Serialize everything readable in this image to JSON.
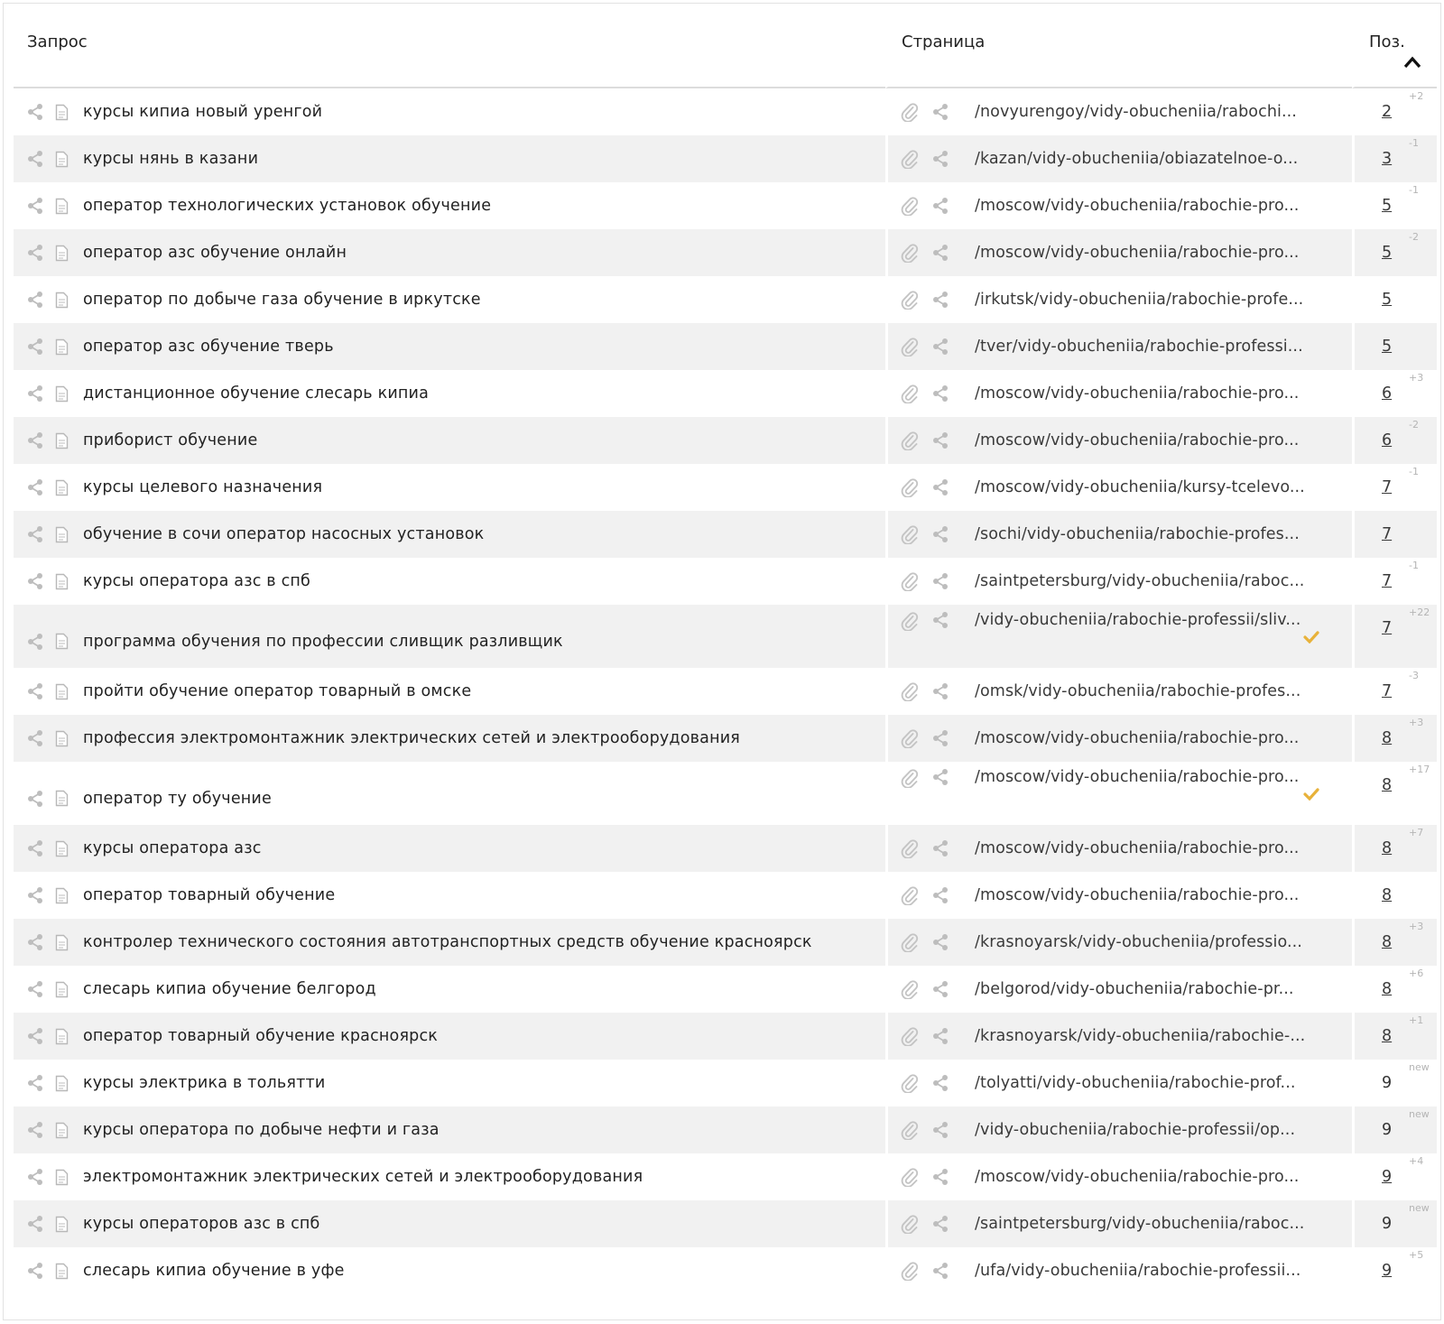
{
  "columns": {
    "query": "Запрос",
    "page": "Страница",
    "position": "Поз."
  },
  "icons": {
    "share": "share-icon",
    "document": "document-icon",
    "link": "paperclip-icon",
    "sort": "chevron-up-icon",
    "check": "checkmark-icon"
  },
  "colors": {
    "check": "#e8b23a",
    "stripe": "#f1f1f1",
    "delta": "#b5b5b5"
  },
  "rows": [
    {
      "query": "курсы кипиа новый уренгой",
      "page": "/novyurengoy/vidy-obucheniia/rabochi...",
      "pos": "2",
      "pos_link": true,
      "delta": "+2",
      "check": false
    },
    {
      "query": "курсы нянь в казани",
      "page": "/kazan/vidy-obucheniia/obiazatelnoe-o...",
      "pos": "3",
      "pos_link": true,
      "delta": "-1",
      "check": false
    },
    {
      "query": "оператор технологических установок обучение",
      "page": "/moscow/vidy-obucheniia/rabochie-pro...",
      "pos": "5",
      "pos_link": true,
      "delta": "-1",
      "check": false
    },
    {
      "query": "оператор азс обучение онлайн",
      "page": "/moscow/vidy-obucheniia/rabochie-pro...",
      "pos": "5",
      "pos_link": true,
      "delta": "-2",
      "check": false
    },
    {
      "query": "оператор по добыче газа обучение в иркутске",
      "page": "/irkutsk/vidy-obucheniia/rabochie-profe...",
      "pos": "5",
      "pos_link": true,
      "delta": "",
      "check": false
    },
    {
      "query": "оператор азс обучение тверь",
      "page": "/tver/vidy-obucheniia/rabochie-professi...",
      "pos": "5",
      "pos_link": true,
      "delta": "",
      "check": false
    },
    {
      "query": "дистанционное обучение слесарь кипиа",
      "page": "/moscow/vidy-obucheniia/rabochie-pro...",
      "pos": "6",
      "pos_link": true,
      "delta": "+3",
      "check": false
    },
    {
      "query": "приборист обучение",
      "page": "/moscow/vidy-obucheniia/rabochie-pro...",
      "pos": "6",
      "pos_link": true,
      "delta": "-2",
      "check": false
    },
    {
      "query": "курсы целевого назначения",
      "page": "/moscow/vidy-obucheniia/kursy-tcelevo...",
      "pos": "7",
      "pos_link": true,
      "delta": "-1",
      "check": false
    },
    {
      "query": "обучение в сочи оператор насосных установок",
      "page": "/sochi/vidy-obucheniia/rabochie-profes...",
      "pos": "7",
      "pos_link": true,
      "delta": "",
      "check": false
    },
    {
      "query": "курсы оператора азс в спб",
      "page": "/saintpetersburg/vidy-obucheniia/raboc...",
      "pos": "7",
      "pos_link": true,
      "delta": "-1",
      "check": false
    },
    {
      "query": "программа обучения по профессии сливщик разливщик",
      "page": "/vidy-obucheniia/rabochie-professii/sliv...",
      "pos": "7",
      "pos_link": true,
      "delta": "+22",
      "check": true
    },
    {
      "query": "пройти обучение оператор товарный в омске",
      "page": "/omsk/vidy-obucheniia/rabochie-profes...",
      "pos": "7",
      "pos_link": true,
      "delta": "-3",
      "check": false
    },
    {
      "query": "профессия электромонтажник электрических сетей и электрооборудования",
      "page": "/moscow/vidy-obucheniia/rabochie-pro...",
      "pos": "8",
      "pos_link": true,
      "delta": "+3",
      "check": false
    },
    {
      "query": "оператор ту обучение",
      "page": "/moscow/vidy-obucheniia/rabochie-pro...",
      "pos": "8",
      "pos_link": true,
      "delta": "+17",
      "check": true
    },
    {
      "query": "курсы оператора азс",
      "page": "/moscow/vidy-obucheniia/rabochie-pro...",
      "pos": "8",
      "pos_link": true,
      "delta": "+7",
      "check": false
    },
    {
      "query": "оператор товарный обучение",
      "page": "/moscow/vidy-obucheniia/rabochie-pro...",
      "pos": "8",
      "pos_link": true,
      "delta": "",
      "check": false
    },
    {
      "query": "контролер технического состояния автотранспортных средств обучение красноярск",
      "page": "/krasnoyarsk/vidy-obucheniia/professio...",
      "pos": "8",
      "pos_link": true,
      "delta": "+3",
      "check": false
    },
    {
      "query": "слесарь кипиа обучение белгород",
      "page": "/belgorod/vidy-obucheniia/rabochie-pr...",
      "pos": "8",
      "pos_link": true,
      "delta": "+6",
      "check": false
    },
    {
      "query": "оператор товарный обучение красноярск",
      "page": "/krasnoyarsk/vidy-obucheniia/rabochie-...",
      "pos": "8",
      "pos_link": true,
      "delta": "+1",
      "check": false
    },
    {
      "query": "курсы электрика в тольятти",
      "page": "/tolyatti/vidy-obucheniia/rabochie-prof...",
      "pos": "9",
      "pos_link": false,
      "delta": "new",
      "check": false
    },
    {
      "query": "курсы оператора по добыче нефти и газа",
      "page": "/vidy-obucheniia/rabochie-professii/op...",
      "pos": "9",
      "pos_link": false,
      "delta": "new",
      "check": false
    },
    {
      "query": "электромонтажник электрических сетей и электрооборудования",
      "page": "/moscow/vidy-obucheniia/rabochie-pro...",
      "pos": "9",
      "pos_link": true,
      "delta": "+4",
      "check": false
    },
    {
      "query": "курсы операторов азс в спб",
      "page": "/saintpetersburg/vidy-obucheniia/raboc...",
      "pos": "9",
      "pos_link": false,
      "delta": "new",
      "check": false
    },
    {
      "query": "слесарь кипиа обучение в уфе",
      "page": "/ufa/vidy-obucheniia/rabochie-professii...",
      "pos": "9",
      "pos_link": true,
      "delta": "+5",
      "check": false
    }
  ]
}
